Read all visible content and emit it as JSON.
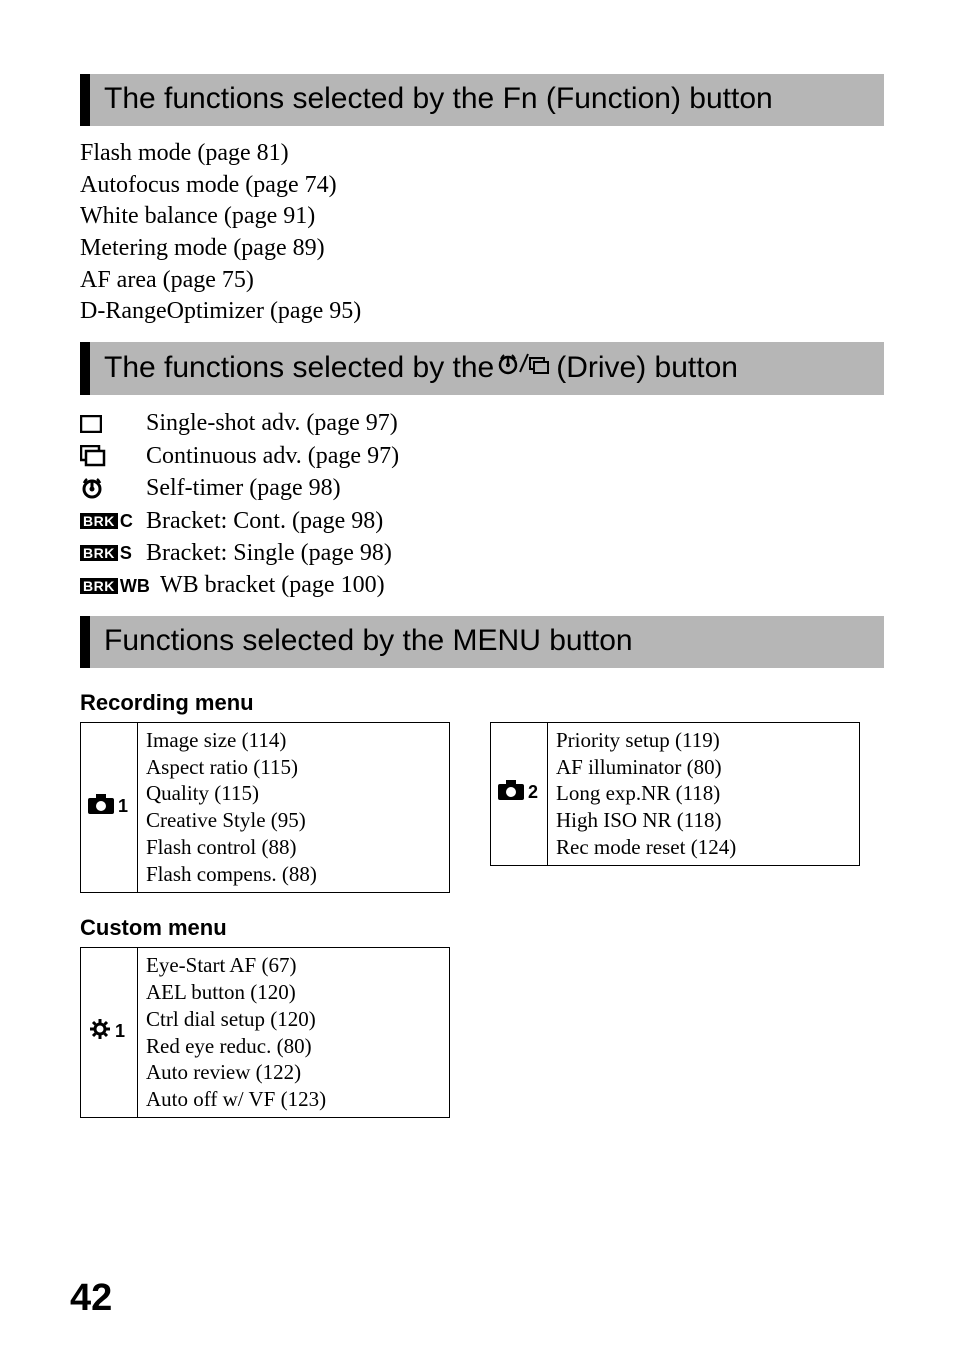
{
  "section1": {
    "title": "The functions selected by the Fn (Function) button",
    "lines": [
      "Flash mode (page 81)",
      "Autofocus mode (page 74)",
      "White balance (page 91)",
      "Metering mode (page 89)",
      "AF area (page 75)",
      "D-RangeOptimizer (page 95)"
    ]
  },
  "section2": {
    "title_prefix": "The functions selected by the ",
    "title_suffix": " (Drive) button",
    "items": [
      {
        "icon": "single",
        "label": " Single-shot adv. (page 97)"
      },
      {
        "icon": "continuous",
        "label": " Continuous adv. (page 97)"
      },
      {
        "icon": "selftimer",
        "label": " Self-timer (page 98)"
      },
      {
        "icon": "brk_c",
        "label": " Bracket: Cont. (page 98)"
      },
      {
        "icon": "brk_s",
        "label": " Bracket: Single (page 98)"
      },
      {
        "icon": "brk_wb",
        "label": " WB bracket (page 100)"
      }
    ]
  },
  "section3": {
    "title": "Functions selected by the MENU button",
    "recording": {
      "heading": "Recording menu",
      "col1_icon": "camera1",
      "col1": [
        "Image size (114)",
        "Aspect ratio (115)",
        "Quality (115)",
        "Creative Style (95)",
        "Flash control (88)",
        "Flash compens. (88)"
      ],
      "col2_icon": "camera2",
      "col2": [
        "Priority setup (119)",
        "AF illuminator (80)",
        "Long exp.NR (118)",
        "High ISO NR (118)",
        "Rec mode reset (124)",
        ""
      ]
    },
    "custom": {
      "heading": "Custom menu",
      "icon": "gear1",
      "items": [
        "Eye-Start AF (67)",
        "AEL button (120)",
        "Ctrl dial setup (120)",
        "Red eye reduc. (80)",
        "Auto review (122)",
        "Auto off w/ VF (123)"
      ]
    }
  },
  "page_number": "42",
  "brk_label": "BRK",
  "brk_c": "C",
  "brk_s": "S",
  "brk_wb": "WB"
}
